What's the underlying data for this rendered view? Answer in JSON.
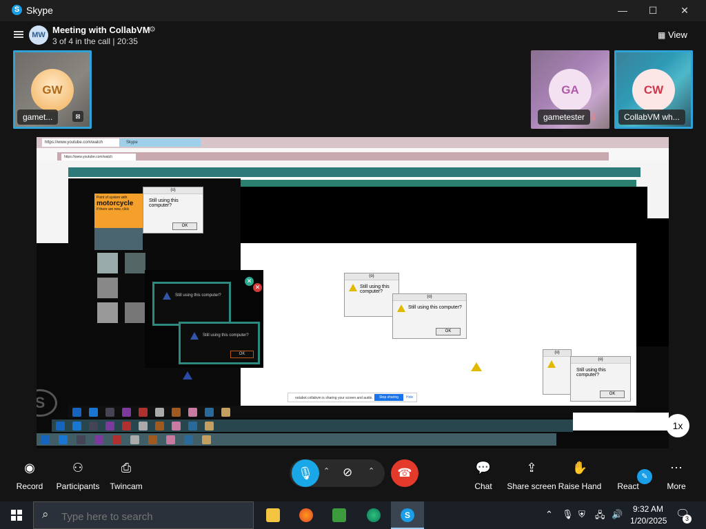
{
  "window": {
    "app_name": "Skype",
    "controls": {
      "minimize": "—",
      "maximize": "☐",
      "close": "✕"
    }
  },
  "header": {
    "avatar_initials": "MW",
    "meeting_title": "Meeting with CollabVM",
    "meeting_status": "3 of 4 in the call | 20:35",
    "view_label": "View"
  },
  "participants": [
    {
      "initials": "GW",
      "name": "gamet...",
      "color": "#f0a860"
    },
    {
      "initials": "GA",
      "name": "gametester",
      "color": "#f0d9ef"
    },
    {
      "initials": "CW",
      "name": "CollabVM wh...",
      "color": "#fde4e4"
    }
  ],
  "shared_screen": {
    "dialog_message": "Still using this computer?",
    "dialog_title": "(o)",
    "ok_label": "OK",
    "ad_text": "motorcycle",
    "ad_line1": "Point of system with",
    "ad_line2": "If there are new, click",
    "share_bar_text": "notabot.collabvm is sharing your screen and audio.",
    "stop_sharing": "Stop sharing",
    "hide": "Hide",
    "browser_url": "https://www.youtube.com/watch",
    "browser_tab": "Skype"
  },
  "speed_badge": "1x",
  "controls": {
    "record": "Record",
    "participants": "Participants",
    "twincam": "Twincam",
    "chat": "Chat",
    "share_screen": "Share screen",
    "raise_hand": "Raise Hand",
    "react": "React",
    "more": "More"
  },
  "taskbar": {
    "search_placeholder": "Type here to search",
    "time": "9:32 AM",
    "date": "1/20/2025",
    "notification_count": "3"
  },
  "colors": {
    "accent": "#1a9ee8",
    "hangup": "#e33a2c",
    "tile_border": "#2ea3d8"
  }
}
